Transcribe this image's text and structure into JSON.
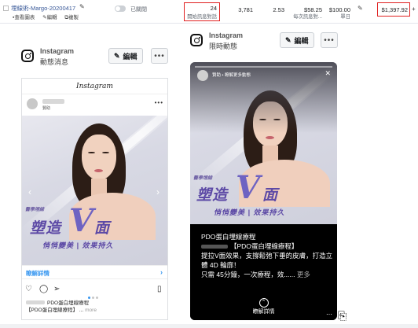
{
  "ad_row": {
    "ad_name": "埋線術-Margo-20200417",
    "actions": [
      "查看圖表",
      "編輯",
      "複製"
    ],
    "status": "已關閉",
    "results_value": "24",
    "results_label": "開始訊息對話",
    "reach": "3,781",
    "frequency": "2.53",
    "cost_per_result": "$58.25",
    "cost_per_result_label": "每次訊息對...",
    "budget": "$100.00",
    "budget_label": "單日",
    "amount_spent": "$1,397.92",
    "highlight_color": "#e02020"
  },
  "feed_panel": {
    "platform": "Instagram",
    "placement": "動態消息",
    "edit_label": "編輯",
    "more_label": "•••",
    "wordmark": "Instagram",
    "sponsored": "贊助",
    "tagline": "醫學埋線",
    "headline_word": "塑造",
    "headline_v": "V",
    "headline_end": "面",
    "slogan": "悄悄變美 | 效果持久",
    "learn_more": "瞭解詳情",
    "caption_line1": "PDO蛋白埋線療程",
    "caption_line2": "【PDO蛋白埋線療程】 ...",
    "caption_more": "more"
  },
  "story_panel": {
    "platform": "Instagram",
    "placement": "限時動態",
    "edit_label": "編輯",
    "more_label": "•••",
    "sponsored": "贊助 • 瞭解更多動態",
    "tagline": "醫學埋線",
    "headline_word": "塑造",
    "headline_v": "V",
    "headline_end": "面",
    "slogan": "悄悄變美 | 效果持久",
    "text_line1": "PDO蛋白埋線療程",
    "text_line2": "【PDO蛋白埋線療程】",
    "text_line3": "提拉V面效果，支撐鬆弛下垂的皮膚，打造立體 4D 輪廓！",
    "text_line4": "只需 45分鐘，一次療程，效......",
    "text_more": "更多",
    "cta": "瞭解詳情"
  },
  "icons": {
    "edit": "pencil-icon",
    "instagram": "instagram-icon",
    "heart": "heart-icon",
    "comment": "comment-icon",
    "share": "send-icon",
    "save": "bookmark-icon"
  }
}
